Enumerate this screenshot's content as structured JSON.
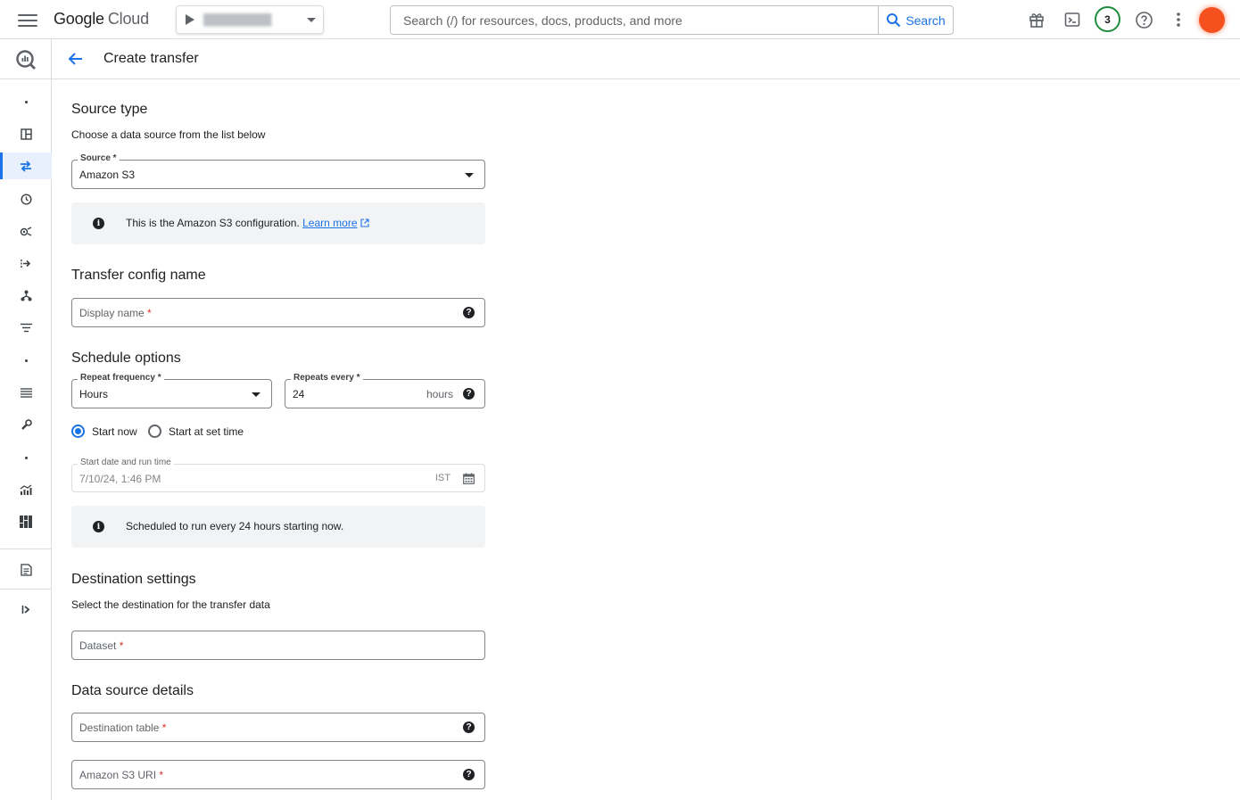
{
  "brand": {
    "google": "Google",
    "cloud": "Cloud"
  },
  "search": {
    "placeholder": "Search (/) for resources, docs, products, and more",
    "button_label": "Search"
  },
  "topbar": {
    "notification_count": "3"
  },
  "page": {
    "title": "Create transfer"
  },
  "source_type": {
    "title": "Source type",
    "subtitle": "Choose a data source from the list below",
    "source_label": "Source *",
    "source_value": "Amazon S3",
    "info_text": "This is the Amazon S3 configuration.",
    "learn_more": "Learn more"
  },
  "transfer_config": {
    "title": "Transfer config name",
    "display_name_placeholder": "Display name",
    "required_mark": "*"
  },
  "schedule": {
    "title": "Schedule options",
    "frequency_label": "Repeat frequency *",
    "frequency_value": "Hours",
    "repeats_label": "Repeats every *",
    "repeats_value": "24",
    "repeats_unit": "hours",
    "radio_start_now": "Start now",
    "radio_start_at_set_time": "Start at set time",
    "selected_radio": "start_now",
    "start_date_label": "Start date and run time",
    "start_date_value": "7/10/24, 1:46 PM",
    "timezone": "IST",
    "info_text": "Scheduled to run every 24 hours starting now."
  },
  "destination": {
    "title": "Destination settings",
    "subtitle": "Select the destination for the transfer data",
    "dataset_placeholder": "Dataset"
  },
  "data_source_details": {
    "title": "Data source details",
    "destination_table_placeholder": "Destination table",
    "s3_uri_placeholder": "Amazon S3 URI"
  },
  "colors": {
    "accent": "#1a73e8",
    "avatar": "#f4511e",
    "badge_ring": "#1e8e3e",
    "info_bg": "#f1f3f4"
  }
}
